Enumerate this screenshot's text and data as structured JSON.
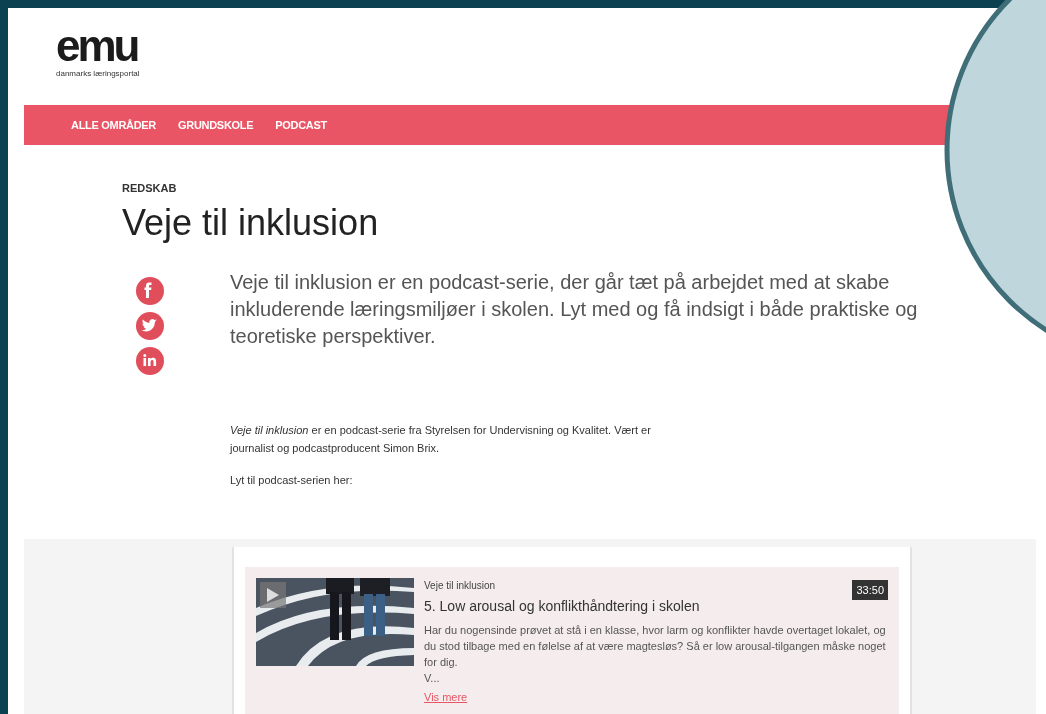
{
  "logo": {
    "mark": "emu",
    "tagline": "danmarks læringsportal"
  },
  "nav": [
    {
      "label": "ALLE OMRÅDER"
    },
    {
      "label": "GRUNDSKOLE"
    },
    {
      "label": "PODCAST"
    }
  ],
  "eyebrow": "REDSKAB",
  "title": "Veje til inklusion",
  "share": [
    {
      "kind": "facebook"
    },
    {
      "kind": "twitter"
    },
    {
      "kind": "linkedin"
    }
  ],
  "lead": "Veje til inklusion er en podcast-serie, der går tæt på arbejdet med at skabe inkluderende læringsmiljøer i skolen. Lyt med og få indsigt i både praktiske og teoretiske perspektiver.",
  "body": [
    "*Veje til inklusion* er en podcast-serie fra Styrelsen for Undervisning og Kvalitet. Vært er journalist og podcastproducent Simon Brix.",
    "Lyt til podcast-serien her:"
  ],
  "episode": {
    "series": "Veje til inklusion",
    "title": "5. Low arousal og konflikthåndtering i skolen",
    "duration": "33:50",
    "description": "Har du nogensinde prøvet at stå i en klasse, hvor larm og konflikter havde overtaget lokalet, og du stod tilbage med en følelse af at være magtesløs? Så er low arousal-tilgangen måske noget for dig.",
    "excerpt": "V...",
    "link": "Vis mere"
  }
}
